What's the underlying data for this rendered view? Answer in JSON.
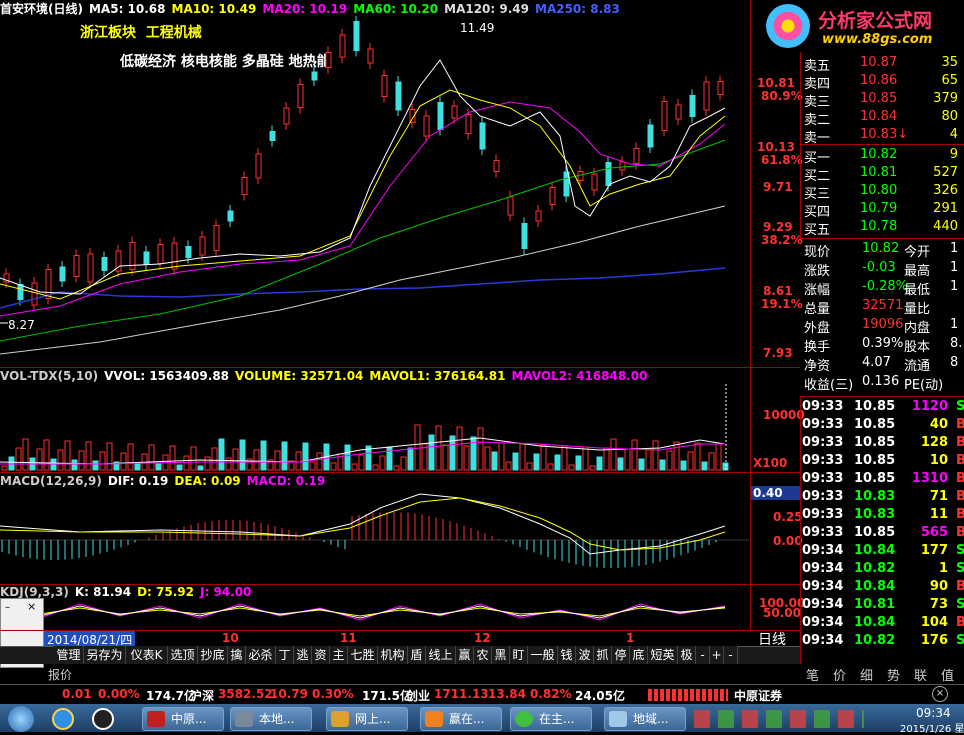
{
  "chart_header": {
    "title": "首安环境(日线)",
    "ma5": "MA5: 10.68",
    "ma10": "MA10: 10.49",
    "ma20": "MA20: 10.19",
    "ma60": "MA60: 10.20",
    "ma120": "MA120: 9.49",
    "ma250": "MA250: 8.83",
    "colors": {
      "ma5": "#ffffff",
      "ma10": "#ffff00",
      "ma20": "#ff00ff",
      "ma60": "#00ff00",
      "ma120": "#dddddd",
      "ma250": "#4060ff"
    }
  },
  "overlay": {
    "sector": "浙江板块  工程机械",
    "concepts": "低碳经济 核电核能 多晶硅 地热能"
  },
  "annotations": {
    "high": "11.49",
    "low": "8.27"
  },
  "price_axis": {
    "levels": [
      {
        "price": "10.81",
        "pct": "80.9%"
      },
      {
        "price": "10.13",
        "pct": "61.8%"
      },
      {
        "price": "9.71",
        "pct": ""
      },
      {
        "price": "9.29",
        "pct": "38.2%"
      },
      {
        "price": "8.61",
        "pct": "19.1%"
      },
      {
        "price": "7.93",
        "pct": ""
      }
    ]
  },
  "vol_header": {
    "name": "VOL-TDX(5,10)",
    "vvol": "VVOL: 1563409.88",
    "volume": "VOLUME: 32571.04",
    "mavol1": "MAVOL1: 376164.81",
    "mavol2": "MAVOL2: 416848.00"
  },
  "vol_axis": {
    "tick": "10000",
    "unit": "X100"
  },
  "macd_header": {
    "name": "MACD(12,26,9)",
    "dif": "DIF: 0.19",
    "dea": "DEA: 0.09",
    "macd": "MACD: 0.19"
  },
  "macd_axis": {
    "current": "0.40",
    "tick1": "0.25",
    "tick2": "0.00"
  },
  "kdj_header": {
    "name": "KDJ(9,3,3)",
    "k": "K: 81.94",
    "d": "D: 75.92",
    "j": "J: 94.00"
  },
  "kdj_axis": {
    "tick1": "100.00",
    "tick2": "50.00"
  },
  "date_axis": {
    "date_box": "2014/08/21/四",
    "months": [
      "10",
      "11",
      "12",
      "1"
    ],
    "period": "日线"
  },
  "toolbar": [
    "管理",
    "另存为",
    "仪表K",
    "选顶",
    "抄底",
    "擒",
    "必杀",
    "丁",
    "逃",
    "资",
    "主",
    "七胜",
    "机构",
    "盾",
    "线上",
    "赢",
    "农",
    "黑",
    "盯",
    "一般",
    "钱",
    "波",
    "抓",
    "停",
    "底",
    "短英",
    "极"
  ],
  "toolbar_extra": [
    "-",
    "+",
    "-"
  ],
  "report_label": "报价",
  "brand": {
    "name": "分析家公式网",
    "url": "www.88gs.com"
  },
  "order_book": {
    "sell": [
      {
        "label": "卖五",
        "price": "10.87",
        "vol": "35"
      },
      {
        "label": "卖四",
        "price": "10.86",
        "vol": "65"
      },
      {
        "label": "卖三",
        "price": "10.85",
        "vol": "379"
      },
      {
        "label": "卖二",
        "price": "10.84",
        "vol": "80"
      },
      {
        "label": "卖一",
        "price": "10.83↓",
        "vol": "4"
      }
    ],
    "buy": [
      {
        "label": "买一",
        "price": "10.82",
        "vol": "9"
      },
      {
        "label": "买二",
        "price": "10.81",
        "vol": "527"
      },
      {
        "label": "买三",
        "price": "10.80",
        "vol": "326"
      },
      {
        "label": "买四",
        "price": "10.79",
        "vol": "291"
      },
      {
        "label": "买五",
        "price": "10.78",
        "vol": "440"
      }
    ]
  },
  "quote": [
    {
      "l1": "现价",
      "v1": "10.82",
      "l2": "今开",
      "v2": "1"
    },
    {
      "l1": "涨跌",
      "v1": "-0.03",
      "l2": "最高",
      "v2": "1"
    },
    {
      "l1": "涨幅",
      "v1": "-0.28%",
      "l2": "最低",
      "v2": "1"
    },
    {
      "l1": "总量",
      "v1": "32571",
      "l2": "量比",
      "v2": ""
    },
    {
      "l1": "外盘",
      "v1": "19096",
      "l2": "内盘",
      "v2": "1"
    },
    {
      "l1": "换手",
      "v1": "0.39%",
      "l2": "股本",
      "v2": "8."
    },
    {
      "l1": "净资",
      "v1": "4.07",
      "l2": "流通",
      "v2": "8"
    },
    {
      "l1": "收益(三)",
      "v1": "0.136",
      "l2": "PE(动)",
      "v2": ""
    }
  ],
  "ticks": [
    {
      "time": "09:33",
      "price": "10.85",
      "vol": "1120",
      "side": "S",
      "pc": "#ffffff",
      "vc": "#ff00ff"
    },
    {
      "time": "09:33",
      "price": "10.85",
      "vol": "40",
      "side": "B",
      "pc": "#ffffff",
      "vc": "#ffff00"
    },
    {
      "time": "09:33",
      "price": "10.85",
      "vol": "128",
      "side": "B",
      "pc": "#ffffff",
      "vc": "#ffff00"
    },
    {
      "time": "09:33",
      "price": "10.85",
      "vol": "10",
      "side": "B",
      "pc": "#ffffff",
      "vc": "#ffff00"
    },
    {
      "time": "09:33",
      "price": "10.85",
      "vol": "1310",
      "side": "B",
      "pc": "#ffffff",
      "vc": "#ff00ff"
    },
    {
      "time": "09:33",
      "price": "10.83",
      "vol": "71",
      "side": "B",
      "pc": "#00ff00",
      "vc": "#ffff00"
    },
    {
      "time": "09:33",
      "price": "10.83",
      "vol": "11",
      "side": "B",
      "pc": "#00ff00",
      "vc": "#ffff00"
    },
    {
      "time": "09:33",
      "price": "10.85",
      "vol": "565",
      "side": "B",
      "pc": "#ffffff",
      "vc": "#ff00ff"
    },
    {
      "time": "09:34",
      "price": "10.84",
      "vol": "177",
      "side": "S",
      "pc": "#00ff00",
      "vc": "#ffff00"
    },
    {
      "time": "09:34",
      "price": "10.82",
      "vol": "1",
      "side": "S",
      "pc": "#00ff00",
      "vc": "#ffff00"
    },
    {
      "time": "09:34",
      "price": "10.84",
      "vol": "90",
      "side": "B",
      "pc": "#00ff00",
      "vc": "#ffff00"
    },
    {
      "time": "09:34",
      "price": "10.81",
      "vol": "73",
      "side": "S",
      "pc": "#00ff00",
      "vc": "#ffff00"
    },
    {
      "time": "09:34",
      "price": "10.84",
      "vol": "104",
      "side": "B",
      "pc": "#00ff00",
      "vc": "#ffff00"
    },
    {
      "time": "09:34",
      "price": "10.82",
      "vol": "176",
      "side": "S",
      "pc": "#00ff00",
      "vc": "#ffff00"
    }
  ],
  "side_tabs": [
    "笔",
    "价",
    "细",
    "势",
    "联",
    "值"
  ],
  "status_bar": {
    "a": "0.01",
    "b": "0.00%",
    "c": "174.7亿",
    "d": "沪深",
    "e": "3582.52",
    "f": "10.79",
    "g": "0.30%",
    "h": "171.5亿",
    "i": "创业",
    "j": "1711.13",
    "k": "13.84",
    "l": "0.82%",
    "m": "24.05亿",
    "n": "中原证券"
  },
  "taskbar": {
    "buttons": [
      "中原...",
      "本地...",
      "网上...",
      "赢在...",
      "在主...",
      "地域..."
    ],
    "clock": "09:34",
    "date": "2015/1/26 星期"
  }
}
